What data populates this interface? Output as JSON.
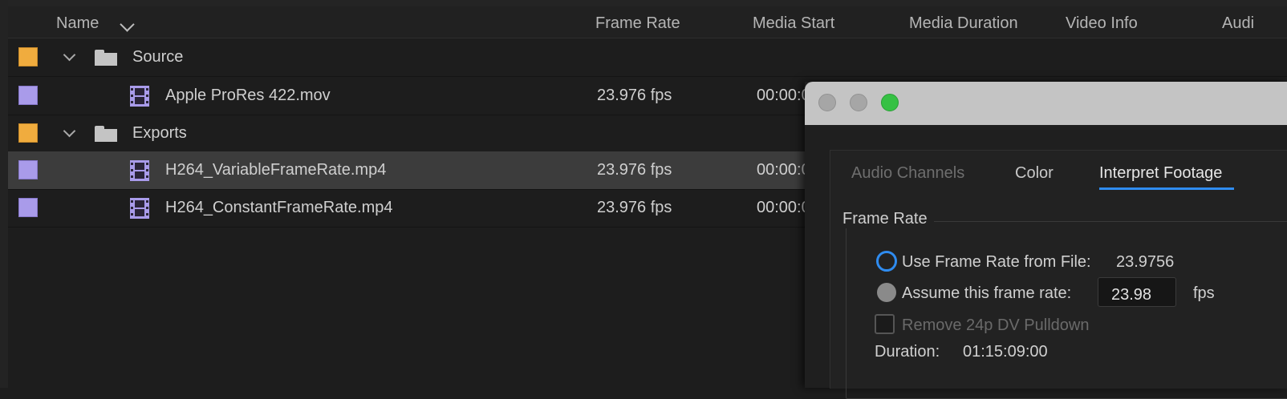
{
  "columns": {
    "name": "Name",
    "frame_rate": "Frame Rate",
    "media_start": "Media Start",
    "media_duration": "Media Duration",
    "video_info": "Video Info",
    "audio_partial": "Audi"
  },
  "rows": [
    {
      "type": "bin",
      "label_color": "#f0ac3e",
      "name": "Source",
      "fps": "",
      "start": ""
    },
    {
      "type": "clip",
      "label_color": "#a99bea",
      "name": "Apple ProRes 422.mov",
      "fps": "23.976 fps",
      "start": "00:00:0"
    },
    {
      "type": "bin",
      "label_color": "#f0ac3e",
      "name": "Exports",
      "fps": "",
      "start": ""
    },
    {
      "type": "clip",
      "label_color": "#a99bea",
      "name": "H264_VariableFrameRate.mp4",
      "fps": "23.976 fps",
      "start": "00:00:0",
      "selected": true
    },
    {
      "type": "clip",
      "label_color": "#a99bea",
      "name": "H264_ConstantFrameRate.mp4",
      "fps": "23.976 fps",
      "start": "00:00:0"
    }
  ],
  "dialog": {
    "tabs": [
      "Audio Channels",
      "Color",
      "Interpret Footage"
    ],
    "active_tab": "Interpret Footage",
    "frame_rate_group": "Frame Rate",
    "use_file_label": "Use Frame Rate from File:",
    "use_file_value": "23.9756",
    "assume_label": "Assume this frame rate:",
    "assume_value": "23.98",
    "fps_unit": "fps",
    "pulldown_label": "Remove 24p DV Pulldown",
    "duration_label": "Duration:",
    "duration_value": "01:15:09:00",
    "accent_color": "#2f8cf0"
  }
}
